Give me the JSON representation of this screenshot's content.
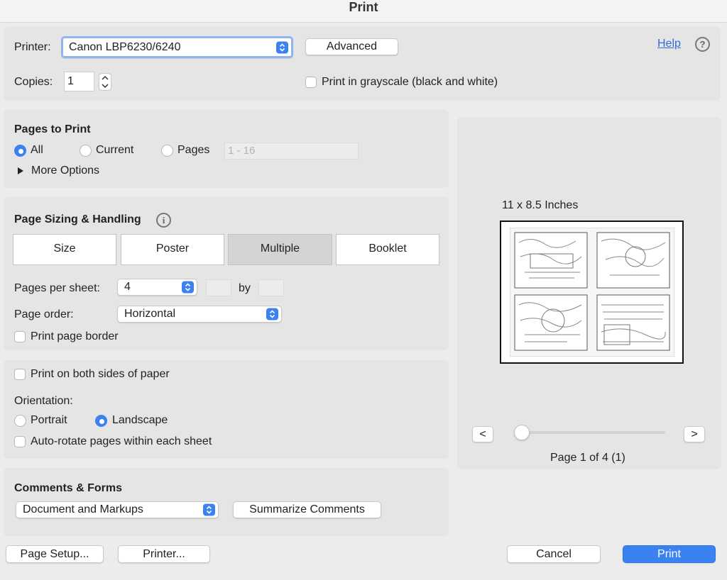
{
  "window": {
    "title": "Print"
  },
  "printer": {
    "label": "Printer:",
    "selected": "Canon LBP6230/6240",
    "advanced_label": "Advanced",
    "help_label": "Help",
    "help_icon": "?",
    "copies_label": "Copies:",
    "copies_value": "1",
    "grayscale_label": "Print in grayscale (black and white)"
  },
  "pages_to_print": {
    "heading": "Pages to Print",
    "all_label": "All",
    "current_label": "Current",
    "pages_label": "Pages",
    "pages_range_placeholder": "1 - 16",
    "more_options_label": "More Options",
    "selected": "All"
  },
  "sizing": {
    "heading": "Page Sizing & Handling",
    "info_icon": "i",
    "tabs": [
      "Size",
      "Poster",
      "Multiple",
      "Booklet"
    ],
    "selected_tab": "Multiple",
    "pages_per_sheet_label": "Pages per sheet:",
    "pages_per_sheet_value": "4",
    "by_label": "by",
    "page_order_label": "Page order:",
    "page_order_value": "Horizontal",
    "border_label": "Print page border"
  },
  "orientation": {
    "both_sides_label": "Print on both sides of paper",
    "heading": "Orientation:",
    "portrait_label": "Portrait",
    "landscape_label": "Landscape",
    "selected": "Landscape",
    "auto_rotate_label": "Auto-rotate pages within each sheet"
  },
  "comments": {
    "heading": "Comments & Forms",
    "dropdown_value": "Document and Markups",
    "summarize_label": "Summarize Comments"
  },
  "preview": {
    "size_label": "11 x 8.5 Inches",
    "prev_label": "<",
    "next_label": ">",
    "page_status": "Page 1 of 4 (1)"
  },
  "footer": {
    "page_setup_label": "Page Setup...",
    "printer_label": "Printer...",
    "cancel_label": "Cancel",
    "print_label": "Print"
  },
  "colors": {
    "accent": "#3b82f1",
    "link": "#2f6fd6"
  }
}
